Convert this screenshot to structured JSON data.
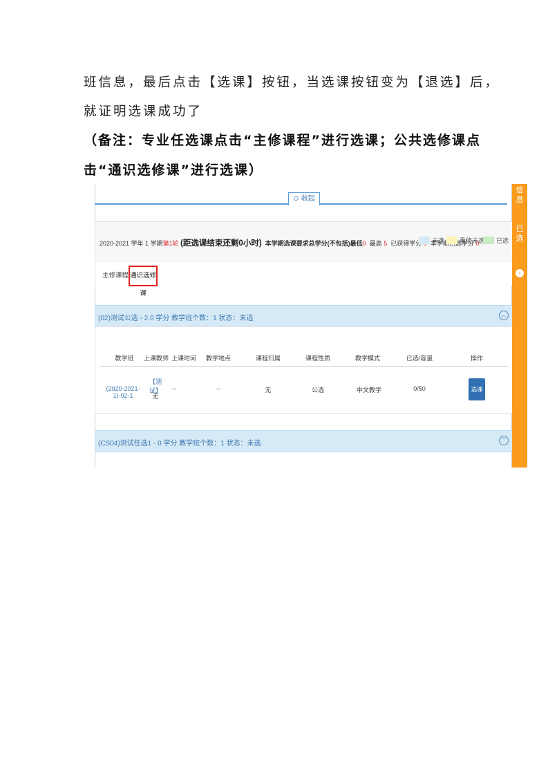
{
  "doc": {
    "line1": "班信息，最后点击【选课】按钮，当选课按钮变为【退选】后，",
    "line2": "就证明选课成功了",
    "note1": "（备注：专业任选课点击“主修课程”进行选课；公共选修课点",
    "note2": "击“通识选修课”进行选课）"
  },
  "screenshot": {
    "collapse_label": "收起",
    "term": {
      "year": "2020-2021 学年 1 学期",
      "round": "第1轮",
      "countdown": "(距选课结束还剩0小时)",
      "req_label": "本学期选课要求总学分(不包括)最低",
      "req_min": "0",
      "max_label": "最高",
      "max_val": "5",
      "earned_label": "已获得学分",
      "earned_val": "0",
      "selected_label": "本学期已选学分",
      "selected_val": "0"
    },
    "legend": {
      "unselected": "未选",
      "reselect": "重修未选",
      "selected": "已选"
    },
    "tabs": {
      "major": "主修课程",
      "general": "通识选修课"
    },
    "course1": "(02)测试公选 - 2.0 学分   教学班个数：1   状态：未选",
    "course2": "(CS04)测试任选1 - 0 学分   教学班个数：1   状态：未选",
    "table": {
      "headers": [
        "教学班",
        "上课教师",
        "上课时间",
        "教学地点",
        "课程归属",
        "课程性质",
        "教学模式",
        "已选/容量",
        "操作"
      ],
      "row": {
        "class": "(2020-2021-1)-02-1",
        "teacher": "【测试】",
        "teacher2": "无",
        "time": "--",
        "place": "--",
        "belong": "无",
        "nature": "公选",
        "mode": "中文教学",
        "capacity": "0/50",
        "action": "选课"
      }
    },
    "sidebar": {
      "info": "信息",
      "selected": "已选"
    }
  },
  "colors": {
    "accent_orange": "#f99b1c",
    "blue_bar": "#d5eaf6",
    "button_blue": "#2f6fb2",
    "highlight_red": "#e02020"
  }
}
